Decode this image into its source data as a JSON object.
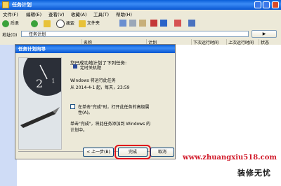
{
  "window": {
    "title": "任务计划"
  },
  "menu": [
    "文件(F)",
    "编辑(E)",
    "查看(V)",
    "收藏(A)",
    "工具(T)",
    "帮助(H)"
  ],
  "toolbar": {
    "back": "后退",
    "search": "搜索",
    "folders": "文件夹"
  },
  "address": {
    "label": "地址(D)",
    "value": "任务计划"
  },
  "columns": [
    "名称",
    "计划",
    "下次运行时间",
    "上次运行时间",
    "状态"
  ],
  "wizard": {
    "title": "任务计划向导",
    "heading": "您已成功地计划了下列任务:",
    "task_name": "定时关机题",
    "run_line": "Windows 将运行此任务",
    "schedule": "从 2014-4-1 起，每天，23:59",
    "checkbox_label_1": "在单击\"完成\"时，打开此任务的高级属",
    "checkbox_label_2": "性(A)。",
    "finish_note_1": "单击\"完成\"，将此任务添加到 Windows 的",
    "finish_note_2": "计划中。",
    "back_button": "< 上一步(B)",
    "finish_button": "完成",
    "cancel_button": "取消"
  },
  "watermark": {
    "url": "www.zhuangxiu518.com",
    "text": "装修无忧"
  },
  "colors": {
    "title_blue": "#0a5fd8",
    "dialog_bg": "#ece9d8",
    "highlight_red": "#e0101a"
  }
}
